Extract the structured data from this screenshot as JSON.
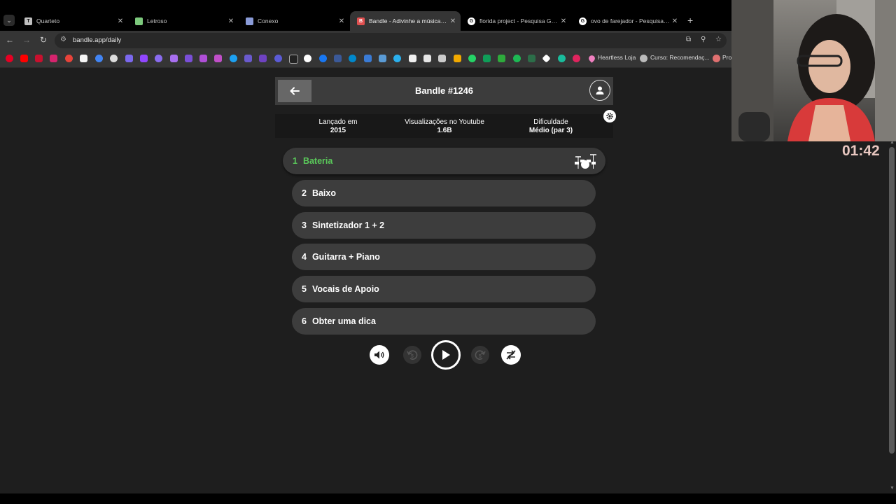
{
  "browser": {
    "tabs": [
      {
        "title": "Quarteto",
        "favicon_letter": "T",
        "favicon_color": "#c0c0c0"
      },
      {
        "title": "Letroso",
        "favicon_letter": "",
        "favicon_color": "#7dc97d"
      },
      {
        "title": "Conexo",
        "favicon_letter": "",
        "favicon_color": "#8a9bd8"
      },
      {
        "title": "Bandle - Adivinhe a música, um",
        "favicon_letter": "B",
        "favicon_color": "#e05050"
      },
      {
        "title": "florida project - Pesquisa Goog",
        "favicon_letter": "G",
        "favicon_color": "#ffffff"
      },
      {
        "title": "ovo de farejador - Pesquisa Goo",
        "favicon_letter": "G",
        "favicon_color": "#ffffff"
      }
    ],
    "url": "bandle.app/daily",
    "bookmarks": {
      "heartless_label": "Heartless Loja",
      "curso_label": "Curso: Recomendaç...",
      "pro_label": "Pro"
    }
  },
  "stream": {
    "timer": "01:42"
  },
  "game": {
    "title": "Bandle #1246",
    "info": [
      {
        "label": "Lançado em",
        "value": "2015"
      },
      {
        "label": "Visualizações no Youtube",
        "value": "1.6B"
      },
      {
        "label": "Dificuldade",
        "value": "Médio (par 3)"
      }
    ],
    "tracks": [
      {
        "num": "1",
        "label": "Bateria",
        "state": "active"
      },
      {
        "num": "2",
        "label": "Baixo",
        "state": "locked"
      },
      {
        "num": "3",
        "label": "Sintetizador 1 + 2",
        "state": "locked"
      },
      {
        "num": "4",
        "label": "Guitarra + Piano",
        "state": "locked"
      },
      {
        "num": "5",
        "label": "Vocais de Apoio",
        "state": "locked"
      },
      {
        "num": "6",
        "label": "Obter uma dica",
        "state": "locked"
      }
    ],
    "controls": {
      "rewind_seconds": "5",
      "forward_seconds": "5"
    },
    "colors": {
      "active_track": "#5ac85a",
      "track_bg": "#3d3d3d"
    }
  }
}
